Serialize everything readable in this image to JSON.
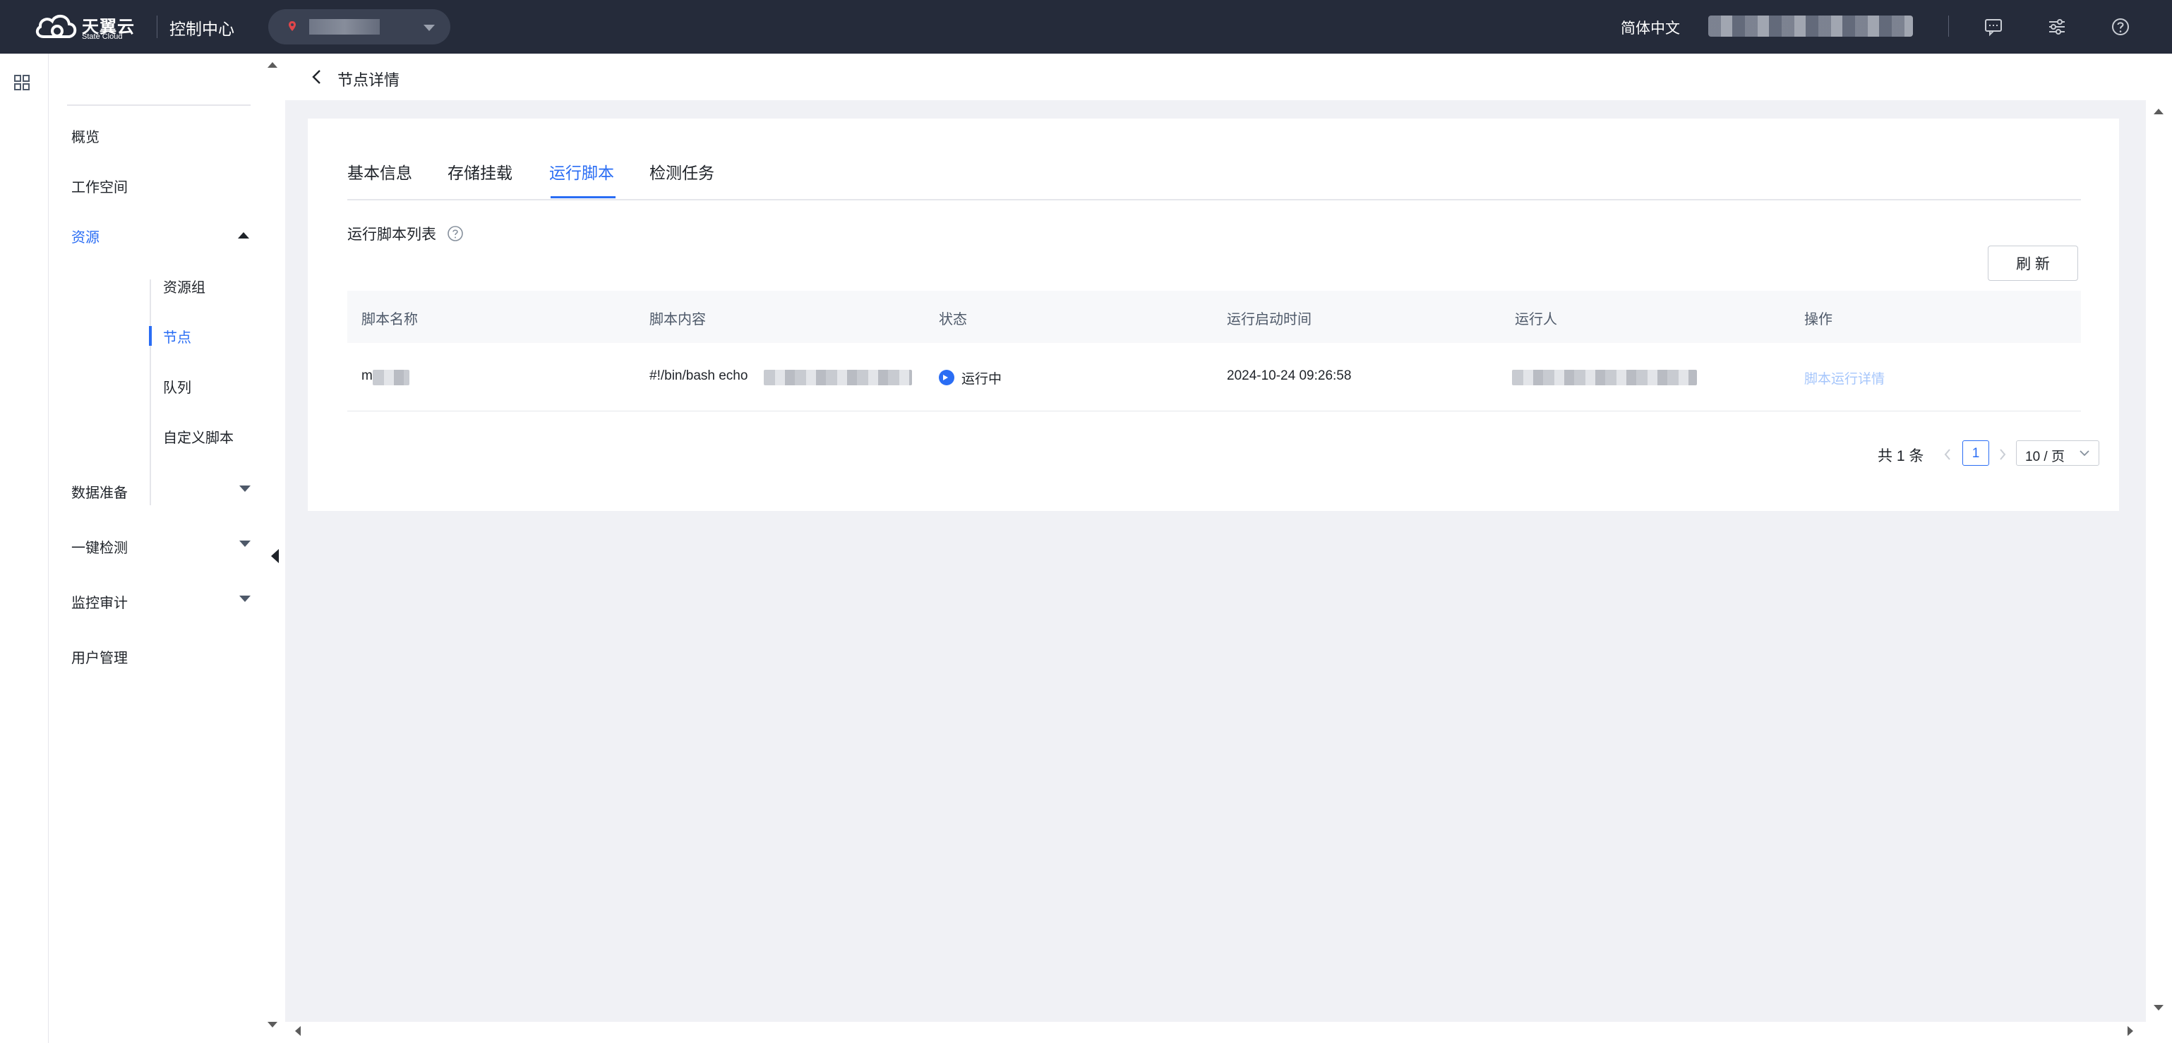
{
  "header": {
    "logo_cn": "天翼云",
    "logo_en": "State Cloud",
    "console_title": "控制中心",
    "language": "简体中文",
    "icons": [
      "message-icon",
      "settings-sliders-icon",
      "help-circle-icon"
    ]
  },
  "sidebar": {
    "items": [
      {
        "label": "概览"
      },
      {
        "label": "工作空间"
      },
      {
        "label": "资源",
        "expanded": true,
        "children": [
          {
            "label": "资源组"
          },
          {
            "label": "节点",
            "active": true
          },
          {
            "label": "队列"
          },
          {
            "label": "自定义脚本"
          }
        ]
      },
      {
        "label": "数据准备"
      },
      {
        "label": "一键检测"
      },
      {
        "label": "监控审计"
      },
      {
        "label": "用户管理"
      }
    ]
  },
  "page": {
    "title": "节点详情",
    "tabs": [
      {
        "label": "基本信息"
      },
      {
        "label": "存储挂载"
      },
      {
        "label": "运行脚本",
        "active": true
      },
      {
        "label": "检测任务"
      }
    ],
    "section_title": "运行脚本列表",
    "refresh_label": "刷 新"
  },
  "table": {
    "columns": [
      "脚本名称",
      "脚本内容",
      "状态",
      "运行启动时间",
      "运行人",
      "操作"
    ],
    "rows": [
      {
        "name": "m",
        "content": "#!/bin/bash echo",
        "status": "运行中",
        "start_time": "2024-10-24 09:26:58",
        "operator": "",
        "action": "脚本运行详情"
      }
    ]
  },
  "pagination": {
    "total": "共 1 条",
    "current": "1",
    "page_size": "10 / 页"
  },
  "colors": {
    "topbar": "#252b3a",
    "accent": "#2a6df4",
    "link_disabled": "#a6c6fb",
    "canvas": "#f0f1f5"
  }
}
